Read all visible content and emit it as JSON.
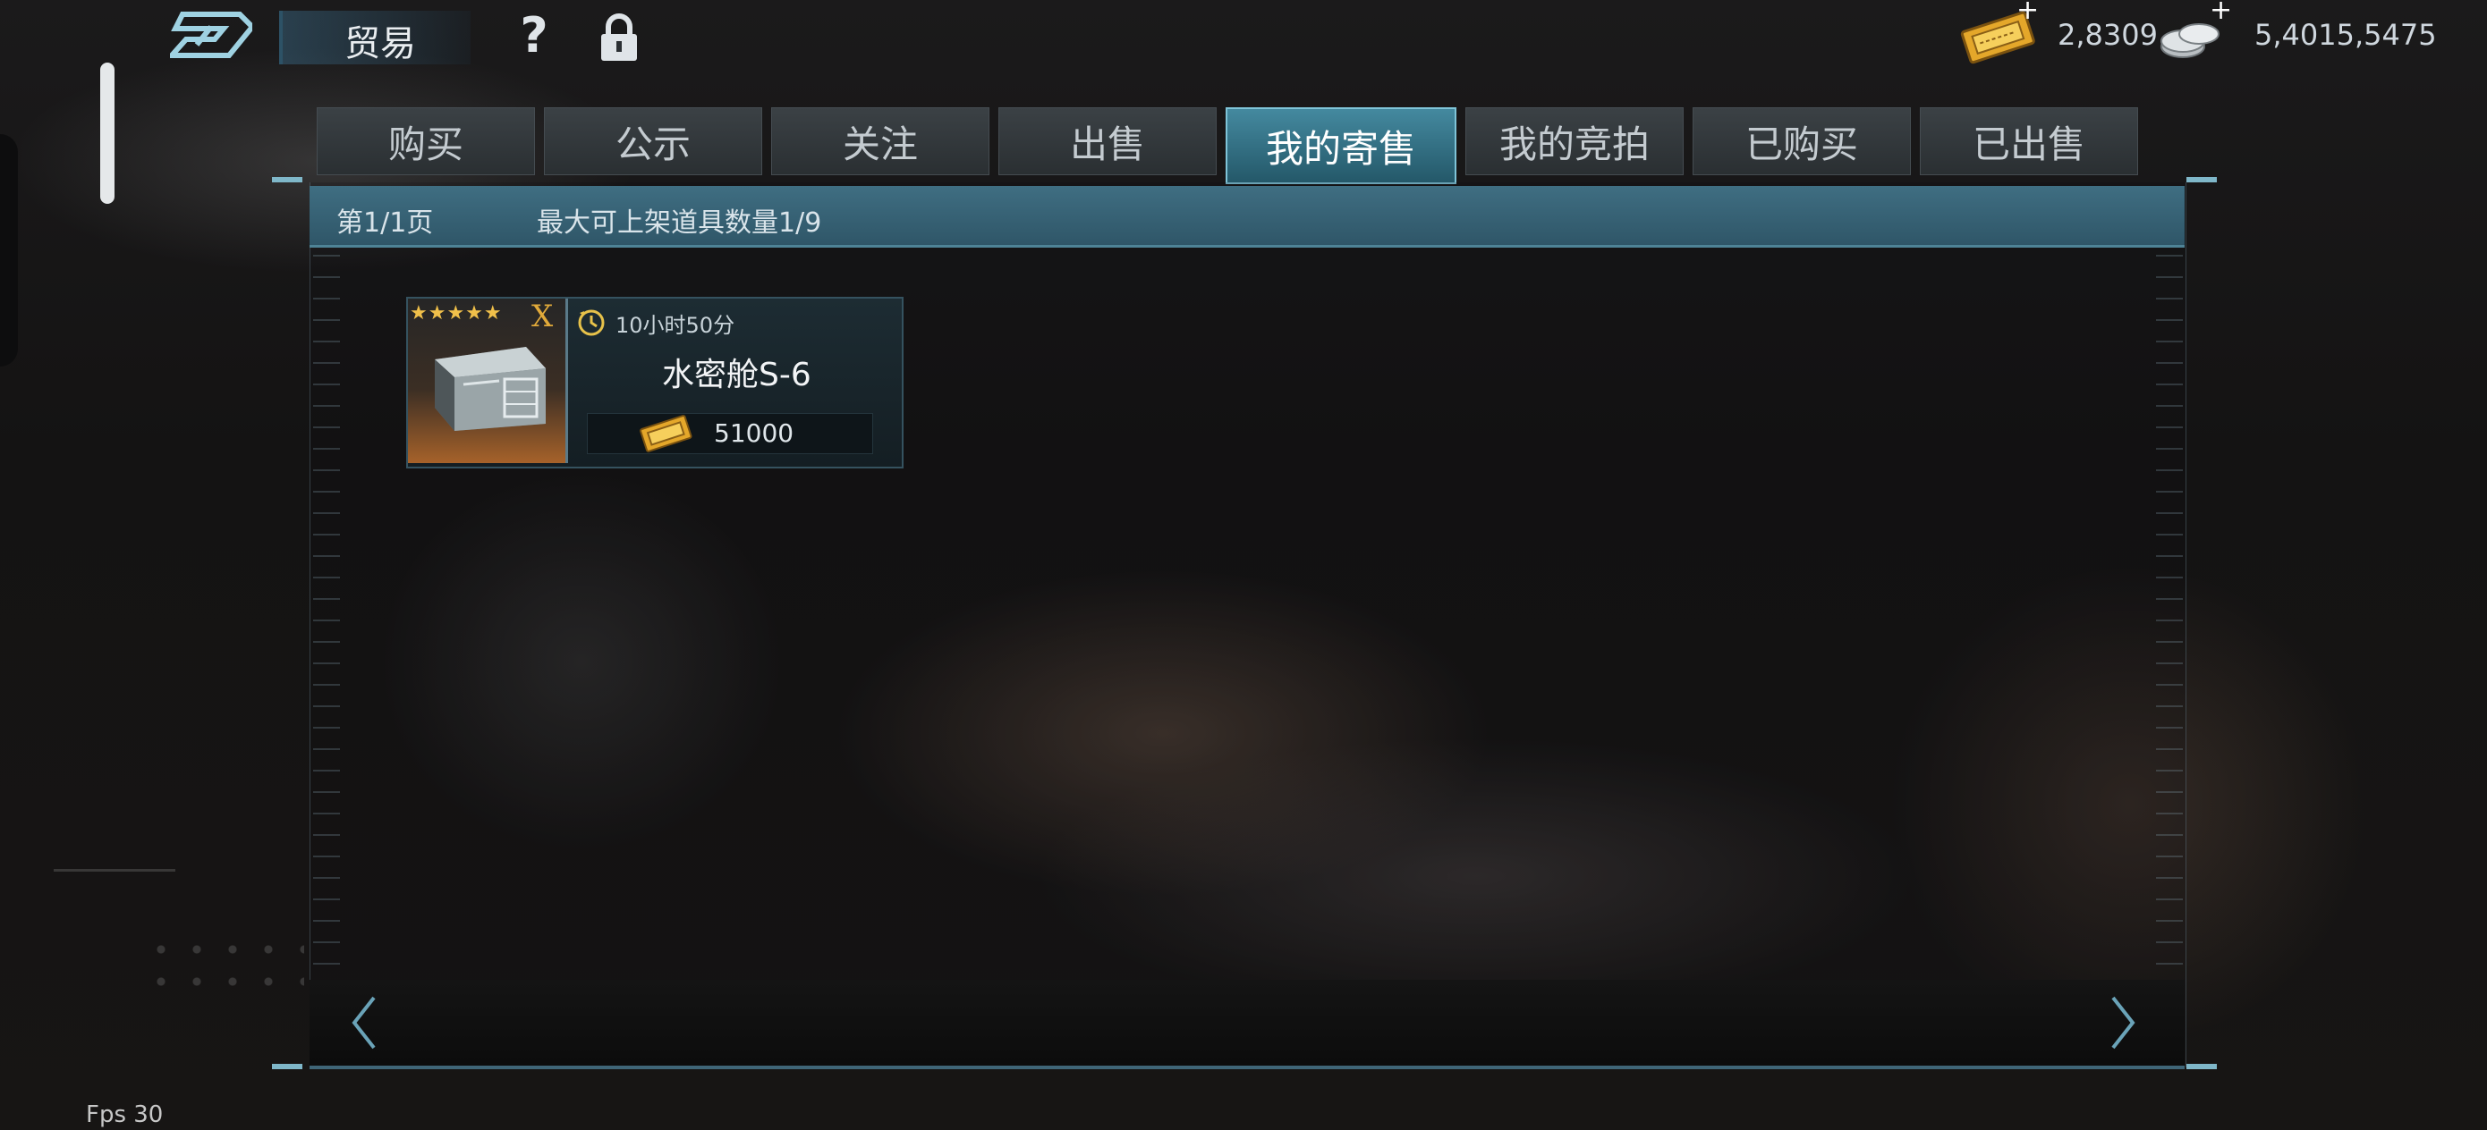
{
  "header": {
    "title": "贸易",
    "help_glyph": "?",
    "currency": [
      {
        "icon": "ticket-icon",
        "value": "2,8309",
        "plus": "+"
      },
      {
        "icon": "silver-coin-icon",
        "value": "5,4015,5475",
        "plus": "+"
      }
    ]
  },
  "tabs": [
    {
      "label": "购买",
      "active": false
    },
    {
      "label": "公示",
      "active": false
    },
    {
      "label": "关注",
      "active": false
    },
    {
      "label": "出售",
      "active": false
    },
    {
      "label": "我的寄售",
      "active": true
    },
    {
      "label": "我的竞拍",
      "active": false
    },
    {
      "label": "已购买",
      "active": false
    },
    {
      "label": "已出售",
      "active": false
    }
  ],
  "panel": {
    "page_label": "第1/1页",
    "max_label": "最大可上架道具数量1/9"
  },
  "items": [
    {
      "stars": "★★★★★",
      "grade": "X",
      "timer": "10小时50分",
      "name": "水密舱S-6",
      "price": "51000",
      "price_icon": "ticket-icon",
      "rarity_color": "#a6622a"
    }
  ],
  "footer": {
    "fps": "Fps 30"
  },
  "colors": {
    "accent": "#44899f",
    "active_tab_border": "#7fc4d8",
    "gold": "#f0c04a"
  }
}
